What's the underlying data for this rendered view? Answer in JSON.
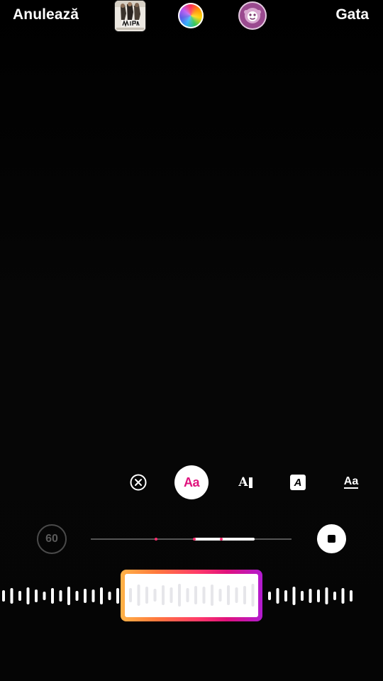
{
  "topbar": {
    "cancel_label": "Anulează",
    "done_label": "Gata",
    "album_art_icon": "album-cover-thumbnail",
    "color_icon": "color-wheel-icon",
    "effect_icon": "face-effect-icon"
  },
  "text_styles": {
    "items": [
      {
        "name": "remove",
        "icon": "circle-x-icon"
      },
      {
        "name": "classic",
        "label": "Aa",
        "selected": true
      },
      {
        "name": "serif-box",
        "label": "A"
      },
      {
        "name": "italic-box",
        "label": "A"
      },
      {
        "name": "underline",
        "label": "Aa"
      }
    ],
    "selected_color": "#e0127d"
  },
  "playback": {
    "duration_label": "60",
    "stop_icon": "stop-icon"
  },
  "waveform": {
    "accent_gradient": [
      "#ffb347",
      "#ff3a6a",
      "#e0127d",
      "#b21bd1"
    ]
  }
}
